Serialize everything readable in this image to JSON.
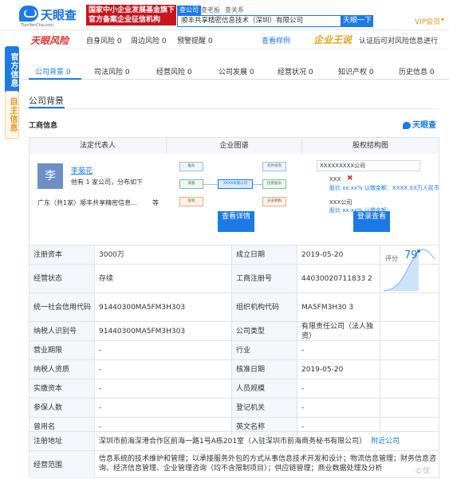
{
  "header": {
    "logo_text": "天眼查",
    "logo_sub": "TianYanCha.com",
    "banner_line1": "国家中小企业发展基金旗下",
    "banner_line2": "官方备案企业征信机构",
    "search_tabs": [
      "查公司",
      "查老板",
      "查关系"
    ],
    "search_value": "顺丰共享精密信息技术（深圳）有限公司",
    "search_button": "天眼一下",
    "vip": "VIP会员",
    "vip_caret": "▾"
  },
  "sidebar": {
    "tab1": "官方信息",
    "tab2": "自主信息"
  },
  "risk_bar": {
    "logo": "天眼风险",
    "items": [
      {
        "label": "自身风险",
        "count": "0"
      },
      {
        "label": "周边风险",
        "count": "0"
      },
      {
        "label": "预警提醒",
        "count": "0"
      }
    ],
    "sample": "查看样例",
    "king": "企业王说",
    "note": "认证后可对风险信息进行"
  },
  "nav_tabs": [
    {
      "label": "公司背景",
      "count": "0"
    },
    {
      "label": "司法风险",
      "count": "0"
    },
    {
      "label": "经营风险",
      "count": "0"
    },
    {
      "label": "公司发展",
      "count": "0"
    },
    {
      "label": "经营状况",
      "count": "0"
    },
    {
      "label": "知识产权",
      "count": "0"
    },
    {
      "label": "历史信息",
      "count": "0"
    }
  ],
  "section_title": "公司背景",
  "sub_title": "工商信息",
  "brand_small": "天眼查",
  "grid_head": {
    "col1": "法定代表人",
    "col2": "企业图谱",
    "col3": "股权结构图"
  },
  "rep": {
    "avatar": "李",
    "name": "李菊花",
    "note": "他有 1 家公司，分布如下",
    "location": "广东（共1家）顺丰共享精密信息...",
    "more": "等"
  },
  "map": {
    "center": "XXXX有限公司",
    "nodes": [
      "股东",
      "高管",
      "投资",
      "对外投资",
      "历史股东",
      "分支机构"
    ],
    "button": "查看详情"
  },
  "equity": {
    "company": "XXXXXXXXX公司",
    "holder1": "XXX",
    "holder1_detail": "股比 xx.xx%  认缴金额：XXXX.XX万人民币",
    "holder2": "XXX公司",
    "holder2_detail": "股比 xx.xx%  认缴金额：",
    "button": "登录查看"
  },
  "score": {
    "label": "评分",
    "value": "79"
  },
  "rows": [
    {
      "l1": "注册资本",
      "v1": "3000万",
      "l2": "成立日期",
      "v2": "2019-05-20"
    },
    {
      "l1": "经营状态",
      "v1": "存续",
      "l2": "工商注册号",
      "v2": "44030020711833 2"
    },
    {
      "l1": "统一社会信用代码",
      "v1": "91440300MA5FM3H303",
      "l2": "组织机构代码",
      "v2": "MA5FM3H30 3"
    },
    {
      "l1": "纳税人识别号",
      "v1": "91440300MA5FM3H303",
      "l2": "公司类型",
      "v2": "有限责任公司（法人独资）"
    },
    {
      "l1": "营业期限",
      "v1": "-",
      "l2": "行业",
      "v2": "-"
    },
    {
      "l1": "纳税人资质",
      "v1": "-",
      "l2": "核准日期",
      "v2": "2019-05-20"
    },
    {
      "l1": "实缴资本",
      "v1": "-",
      "l2": "人员规模",
      "v2": "-"
    },
    {
      "l1": "参保人数",
      "v1": "-",
      "l2": "登记机关",
      "v2": "-"
    },
    {
      "l1": "曾用名",
      "v1": "-",
      "l2": "英文名称",
      "v2": "-"
    }
  ],
  "address": {
    "label": "注册地址",
    "value": "深圳市前海深港合作区前海一路1号A栋201室（入驻深圳市前海商务秘书有限公司）",
    "link": "附近公司"
  },
  "scope": {
    "label": "经营范围",
    "value": "信息系统的技术维护和管理；以承接服务外包的方式从事信息技术开发和设计；物流信息管理；财务信息咨询、经济信息管理、企业管理咨询（均不含限制项目）；供应链管理；商业数据处理及分析"
  },
  "watermark": "©优"
}
